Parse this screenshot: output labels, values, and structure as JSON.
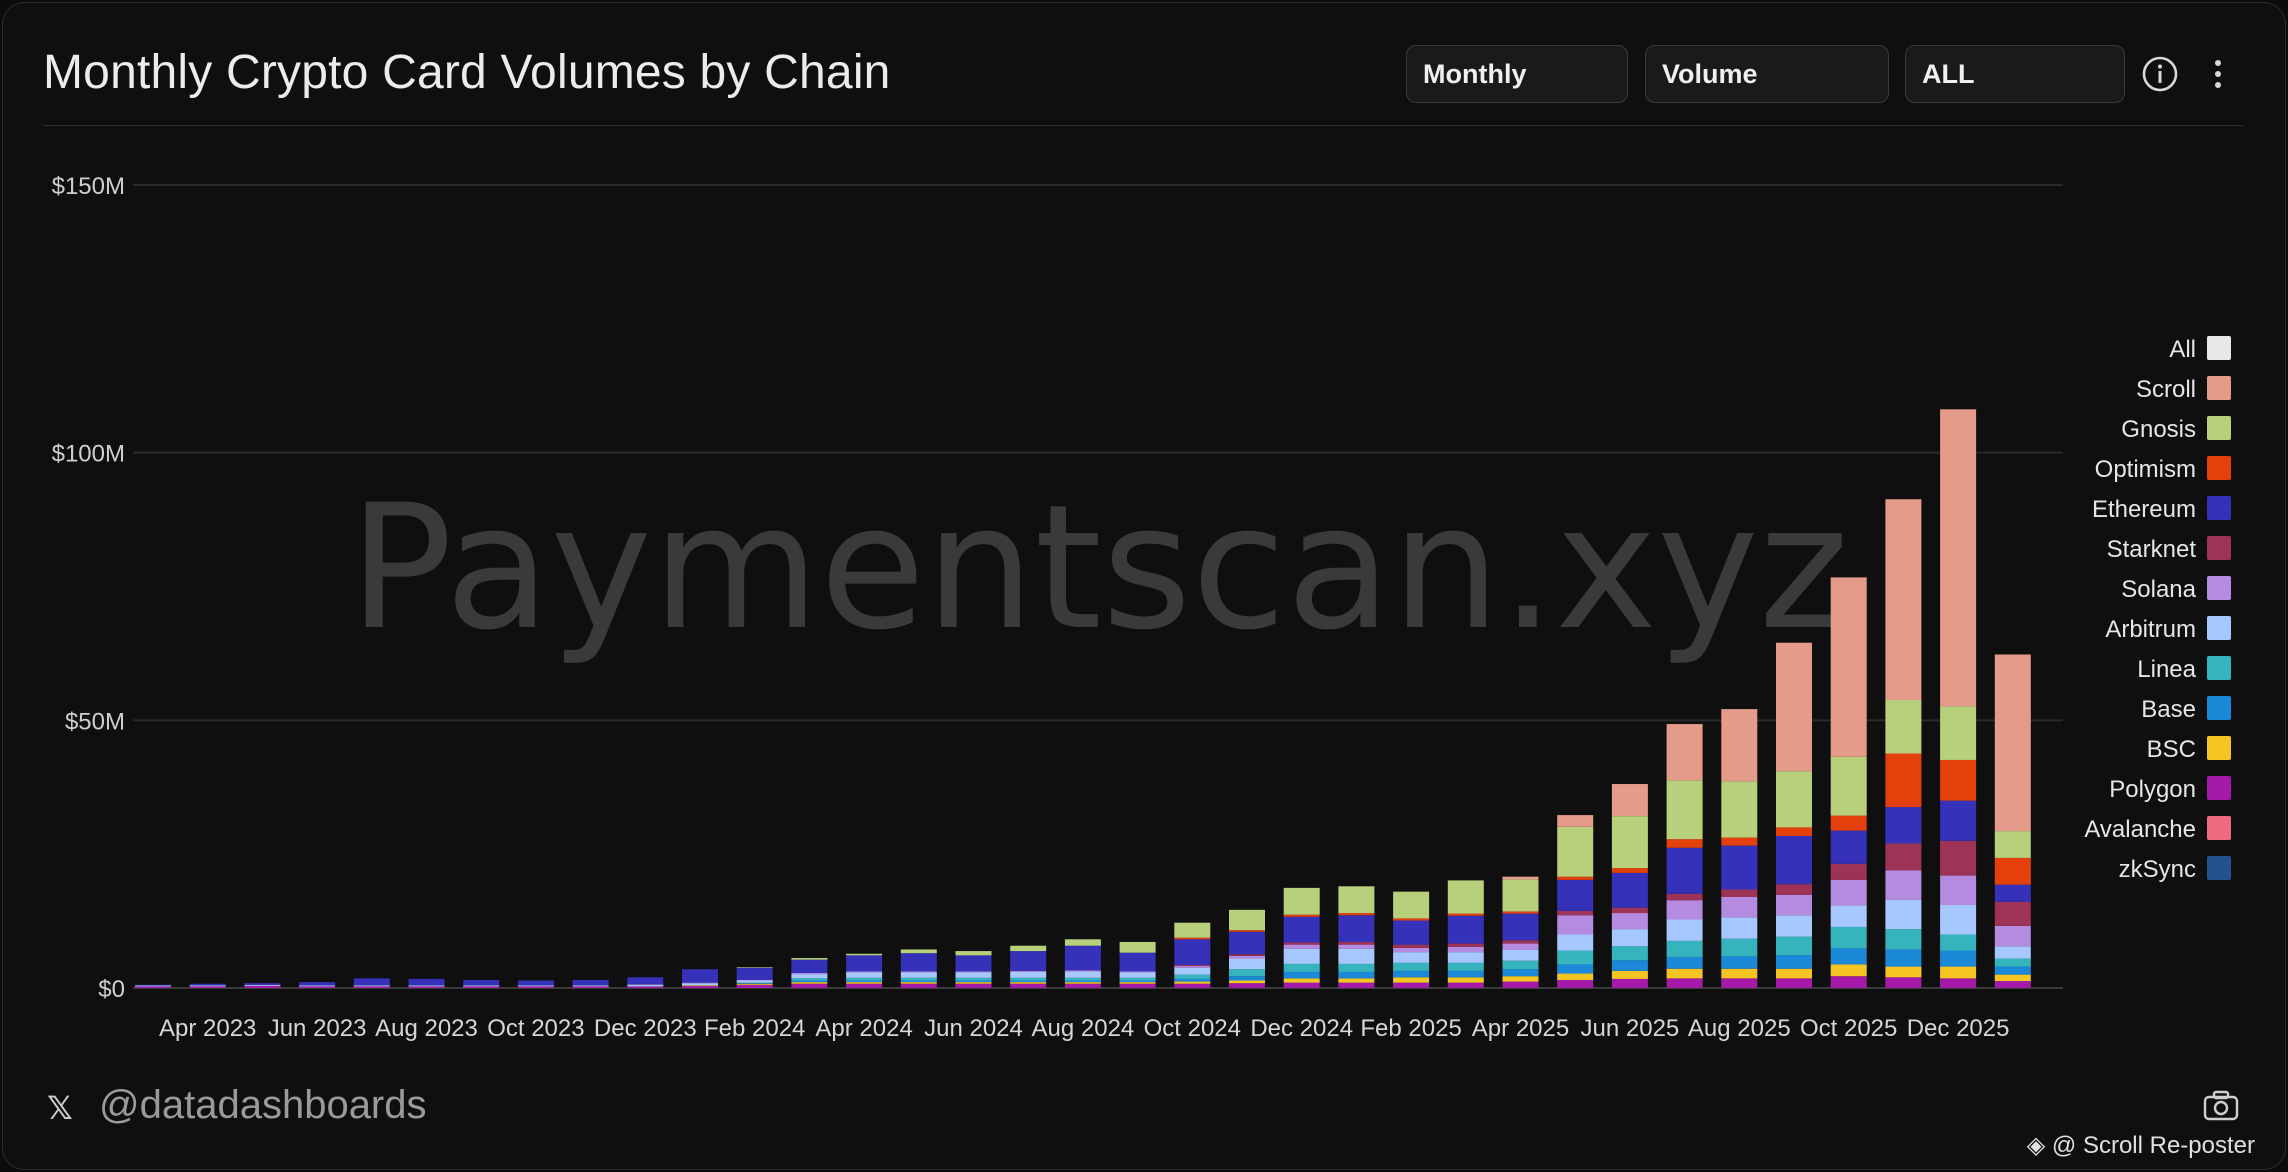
{
  "header": {
    "title": "Monthly Crypto Card Volumes by Chain",
    "period_select": "Monthly",
    "metric_select": "Volume",
    "range_select": "ALL",
    "info_icon": "info-icon",
    "menu_icon": "more-vertical-icon"
  },
  "footer": {
    "x_icon": "𝕏",
    "handle": "@datadashboards",
    "camera_icon": "camera-icon",
    "credit": "@ Scroll Re-poster",
    "credit_icon": "diamond-icon"
  },
  "watermark": "Paymentscan.xyz",
  "colors": {
    "background": "#0f0f0f",
    "grid": "#2a2a2a",
    "text": "#e6e6e6"
  },
  "chart_data": {
    "type": "bar",
    "stacked": true,
    "title": "Monthly Crypto Card Volumes by Chain",
    "ylim": [
      0,
      150
    ],
    "y_ticks": [
      "$0",
      "$50M",
      "$100M",
      "$150M"
    ],
    "y_tick_values": [
      0,
      50,
      100,
      150
    ],
    "x_tick_labels": [
      "Apr 2023",
      "Jun 2023",
      "Aug 2023",
      "Oct 2023",
      "Dec 2023",
      "Feb 2024",
      "Apr 2024",
      "Jun 2024",
      "Aug 2024",
      "Oct 2024",
      "Dec 2024",
      "Feb 2025",
      "Apr 2025",
      "Jun 2025",
      "Aug 2025",
      "Oct 2025",
      "Dec 2025"
    ],
    "categories": [
      "Mar 2023",
      "Apr 2023",
      "May 2023",
      "Jun 2023",
      "Jul 2023",
      "Aug 2023",
      "Sep 2023",
      "Oct 2023",
      "Nov 2023",
      "Dec 2023",
      "Jan 2024",
      "Feb 2024",
      "Mar 2024",
      "Apr 2024",
      "May 2024",
      "Jun 2024",
      "Jul 2024",
      "Aug 2024",
      "Sep 2024",
      "Oct 2024",
      "Nov 2024",
      "Dec 2024",
      "Jan 2025",
      "Feb 2025",
      "Mar 2025",
      "Apr 2025",
      "May 2025",
      "Jun 2025",
      "Jul 2025",
      "Aug 2025",
      "Sep 2025",
      "Oct 2025",
      "Nov 2025",
      "Dec 2025",
      "Jan 2026"
    ],
    "legend_position": "right",
    "legend": [
      "All",
      "Scroll",
      "Gnosis",
      "Optimism",
      "Ethereum",
      "Starknet",
      "Solana",
      "Arbitrum",
      "Linea",
      "Base",
      "BSC",
      "Polygon",
      "Avalanche",
      "zkSync"
    ],
    "series": [
      {
        "name": "zkSync",
        "color": "#24518f",
        "values": [
          0,
          0,
          0,
          0,
          0,
          0,
          0,
          0,
          0,
          0,
          0,
          0,
          0,
          0,
          0,
          0,
          0,
          0,
          0,
          0,
          0,
          0,
          0,
          0,
          0,
          0,
          0,
          0,
          0,
          0,
          0,
          0,
          0,
          0,
          0
        ]
      },
      {
        "name": "Avalanche",
        "color": "#f06a82",
        "values": [
          0,
          0,
          0,
          0,
          0,
          0,
          0,
          0,
          0,
          0,
          0,
          0,
          0,
          0,
          0,
          0,
          0,
          0,
          0,
          0,
          0,
          0,
          0,
          0,
          0,
          0,
          0,
          0,
          0,
          0,
          0,
          0,
          0,
          0,
          0
        ]
      },
      {
        "name": "Polygon",
        "color": "#a51aa8",
        "values": [
          0.3,
          0.3,
          0.4,
          0.3,
          0.3,
          0.3,
          0.3,
          0.3,
          0.3,
          0.3,
          0.4,
          0.6,
          0.8,
          0.8,
          0.8,
          0.8,
          0.8,
          0.8,
          0.8,
          0.8,
          0.9,
          1.0,
          1.0,
          1.0,
          1.0,
          1.2,
          1.5,
          1.7,
          1.8,
          1.8,
          1.8,
          2.2,
          2.0,
          1.8,
          1.3
        ]
      },
      {
        "name": "BSC",
        "color": "#f5c623",
        "values": [
          0,
          0,
          0,
          0,
          0,
          0,
          0,
          0,
          0,
          0,
          0.1,
          0.2,
          0.3,
          0.3,
          0.3,
          0.3,
          0.3,
          0.3,
          0.3,
          0.4,
          0.5,
          0.8,
          0.8,
          1.0,
          1.0,
          1.0,
          1.2,
          1.5,
          1.8,
          1.8,
          1.8,
          2.2,
          2.0,
          2.2,
          1.2
        ]
      },
      {
        "name": "Base",
        "color": "#1b88d8",
        "values": [
          0,
          0,
          0,
          0,
          0,
          0,
          0,
          0,
          0,
          0,
          0,
          0.1,
          0.3,
          0.3,
          0.3,
          0.3,
          0.3,
          0.3,
          0.3,
          0.5,
          0.8,
          1.2,
          1.2,
          1.2,
          1.2,
          1.3,
          1.7,
          2.0,
          2.2,
          2.3,
          2.5,
          3.0,
          3.2,
          3.0,
          1.5
        ]
      },
      {
        "name": "Linea",
        "color": "#35b4be",
        "values": [
          0,
          0,
          0,
          0,
          0,
          0,
          0,
          0,
          0,
          0,
          0,
          0.1,
          0.4,
          0.5,
          0.5,
          0.5,
          0.5,
          0.5,
          0.5,
          0.8,
          1.3,
          1.5,
          1.5,
          1.5,
          1.5,
          1.6,
          2.6,
          2.6,
          3.0,
          3.3,
          3.5,
          4.0,
          3.8,
          3.0,
          1.5
        ]
      },
      {
        "name": "Arbitrum",
        "color": "#a6c8ff",
        "values": [
          0.2,
          0.2,
          0.2,
          0.2,
          0.2,
          0.2,
          0.2,
          0.2,
          0.2,
          0.3,
          0.4,
          0.4,
          0.8,
          1.0,
          1.0,
          1.0,
          1.1,
          1.2,
          1.0,
          1.3,
          2.0,
          2.8,
          2.8,
          2.0,
          2.0,
          2.0,
          3.0,
          3.2,
          4.0,
          4.0,
          4.0,
          4.0,
          5.5,
          5.5,
          2.3
        ]
      },
      {
        "name": "Solana",
        "color": "#b48be0",
        "values": [
          0,
          0,
          0,
          0,
          0,
          0,
          0,
          0,
          0,
          0.1,
          0.1,
          0.1,
          0.2,
          0.2,
          0.2,
          0.2,
          0.2,
          0.2,
          0.2,
          0.3,
          0.5,
          0.8,
          0.8,
          0.8,
          1.0,
          1.2,
          3.6,
          3.0,
          3.6,
          3.8,
          3.8,
          4.8,
          5.5,
          5.5,
          3.8
        ]
      },
      {
        "name": "Starknet",
        "color": "#9e3358",
        "values": [
          0,
          0,
          0,
          0,
          0,
          0,
          0,
          0,
          0,
          0,
          0,
          0,
          0,
          0,
          0,
          0,
          0,
          0,
          0,
          0.2,
          0.3,
          0.4,
          0.5,
          0.6,
          0.6,
          0.6,
          0.8,
          1.0,
          1.2,
          1.4,
          2.0,
          3.0,
          5.0,
          6.5,
          4.5
        ]
      },
      {
        "name": "Ethereum",
        "color": "#3531b8",
        "values": [
          0.1,
          0.3,
          0.3,
          0.6,
          1.3,
          1.2,
          1.0,
          0.9,
          1.0,
          1.3,
          2.5,
          2.3,
          2.5,
          3.0,
          3.4,
          3.0,
          3.7,
          4.6,
          3.5,
          4.8,
          4.2,
          4.8,
          5.0,
          4.5,
          5.2,
          5.0,
          5.8,
          6.5,
          8.6,
          8.2,
          9.0,
          6.2,
          6.8,
          7.5,
          3.2
        ]
      },
      {
        "name": "Optimism",
        "color": "#e4400c",
        "values": [
          0,
          0,
          0,
          0,
          0,
          0,
          0,
          0,
          0,
          0,
          0,
          0,
          0,
          0,
          0,
          0,
          0,
          0,
          0,
          0,
          0,
          0,
          0,
          0,
          0,
          0,
          0,
          0,
          0,
          0,
          0,
          0,
          0,
          0,
          0
        ]
      },
      {
        "name": "Gnosis",
        "color": "#b8d07c",
        "values": [
          0,
          0,
          0,
          0,
          0,
          0,
          0,
          0,
          0,
          0,
          0,
          0.1,
          0.3,
          0.3,
          0.7,
          0.8,
          1.0,
          1.2,
          2.0,
          2.8,
          3.8,
          5.0,
          5.0,
          5.0,
          6.2,
          6.0,
          9.3,
          9.7,
          11.0,
          10.5,
          10.5,
          11.0,
          10.0,
          10.0,
          5.0
        ]
      },
      {
        "name": "Scroll",
        "color": "#e59b8a",
        "values": [
          0,
          0,
          0,
          0,
          0,
          0,
          0,
          0,
          0,
          0,
          0,
          0,
          0,
          0,
          0,
          0,
          0,
          0,
          0,
          0,
          0,
          0,
          0,
          0,
          0,
          0.5,
          2.2,
          6.0,
          10.5,
          13.5,
          24.0,
          33.5,
          37.5,
          55.5,
          33.0
        ]
      }
    ],
    "patch": {
      "Optimism": [
        0,
        0,
        0,
        0,
        0,
        0,
        0,
        0,
        0,
        0,
        0,
        0,
        0,
        0,
        0,
        0,
        0,
        0,
        0,
        0.3,
        0.3,
        0.4,
        0.4,
        0.4,
        0.4,
        0.4,
        0.6,
        0.9,
        1.6,
        1.5,
        1.6,
        2.8,
        10.0,
        7.6,
        5.0
      ]
    },
    "all_color": "#e8e8e8"
  }
}
